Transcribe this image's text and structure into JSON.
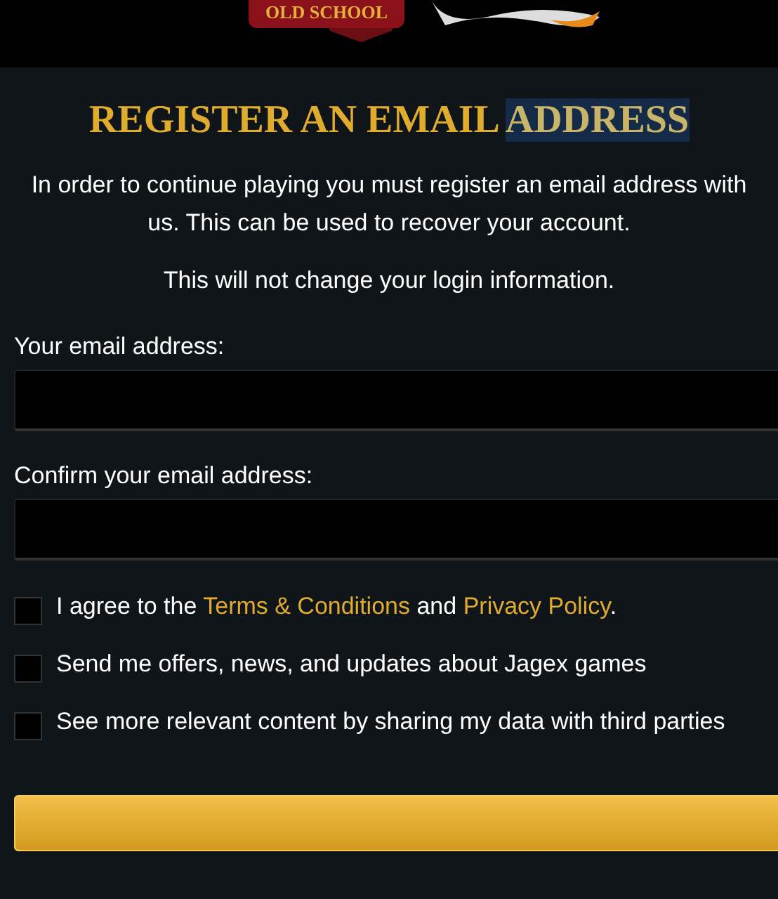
{
  "logo": {
    "tagline": "OLD SCHOOL"
  },
  "title_parts": [
    {
      "text": "REGISTER AN EMAIL",
      "selected": false
    },
    {
      "text": "ADDRESS",
      "selected": true
    }
  ],
  "intro": [
    "In order to continue playing you must register an email address with us. This can be used to recover your account.",
    "This will not change your login information."
  ],
  "fields": [
    {
      "label": "Your email address:"
    },
    {
      "label": "Confirm your email address:"
    }
  ],
  "consents": [
    {
      "checked": false,
      "parts": [
        {
          "text": "I agree to the ",
          "kind": "plain"
        },
        {
          "text": "Terms & Conditions",
          "kind": "link"
        },
        {
          "text": " and ",
          "kind": "plain"
        },
        {
          "text": "Privacy Policy",
          "kind": "link"
        },
        {
          "text": ".",
          "kind": "plain"
        }
      ]
    },
    {
      "checked": false,
      "parts": [
        {
          "text": "Send me offers, news, and updates about Jagex games",
          "kind": "plain"
        }
      ]
    },
    {
      "checked": false,
      "parts": [
        {
          "text": "See more relevant content by sharing my data with third parties",
          "kind": "plain"
        }
      ]
    }
  ],
  "submit": {
    "kind": "button"
  }
}
